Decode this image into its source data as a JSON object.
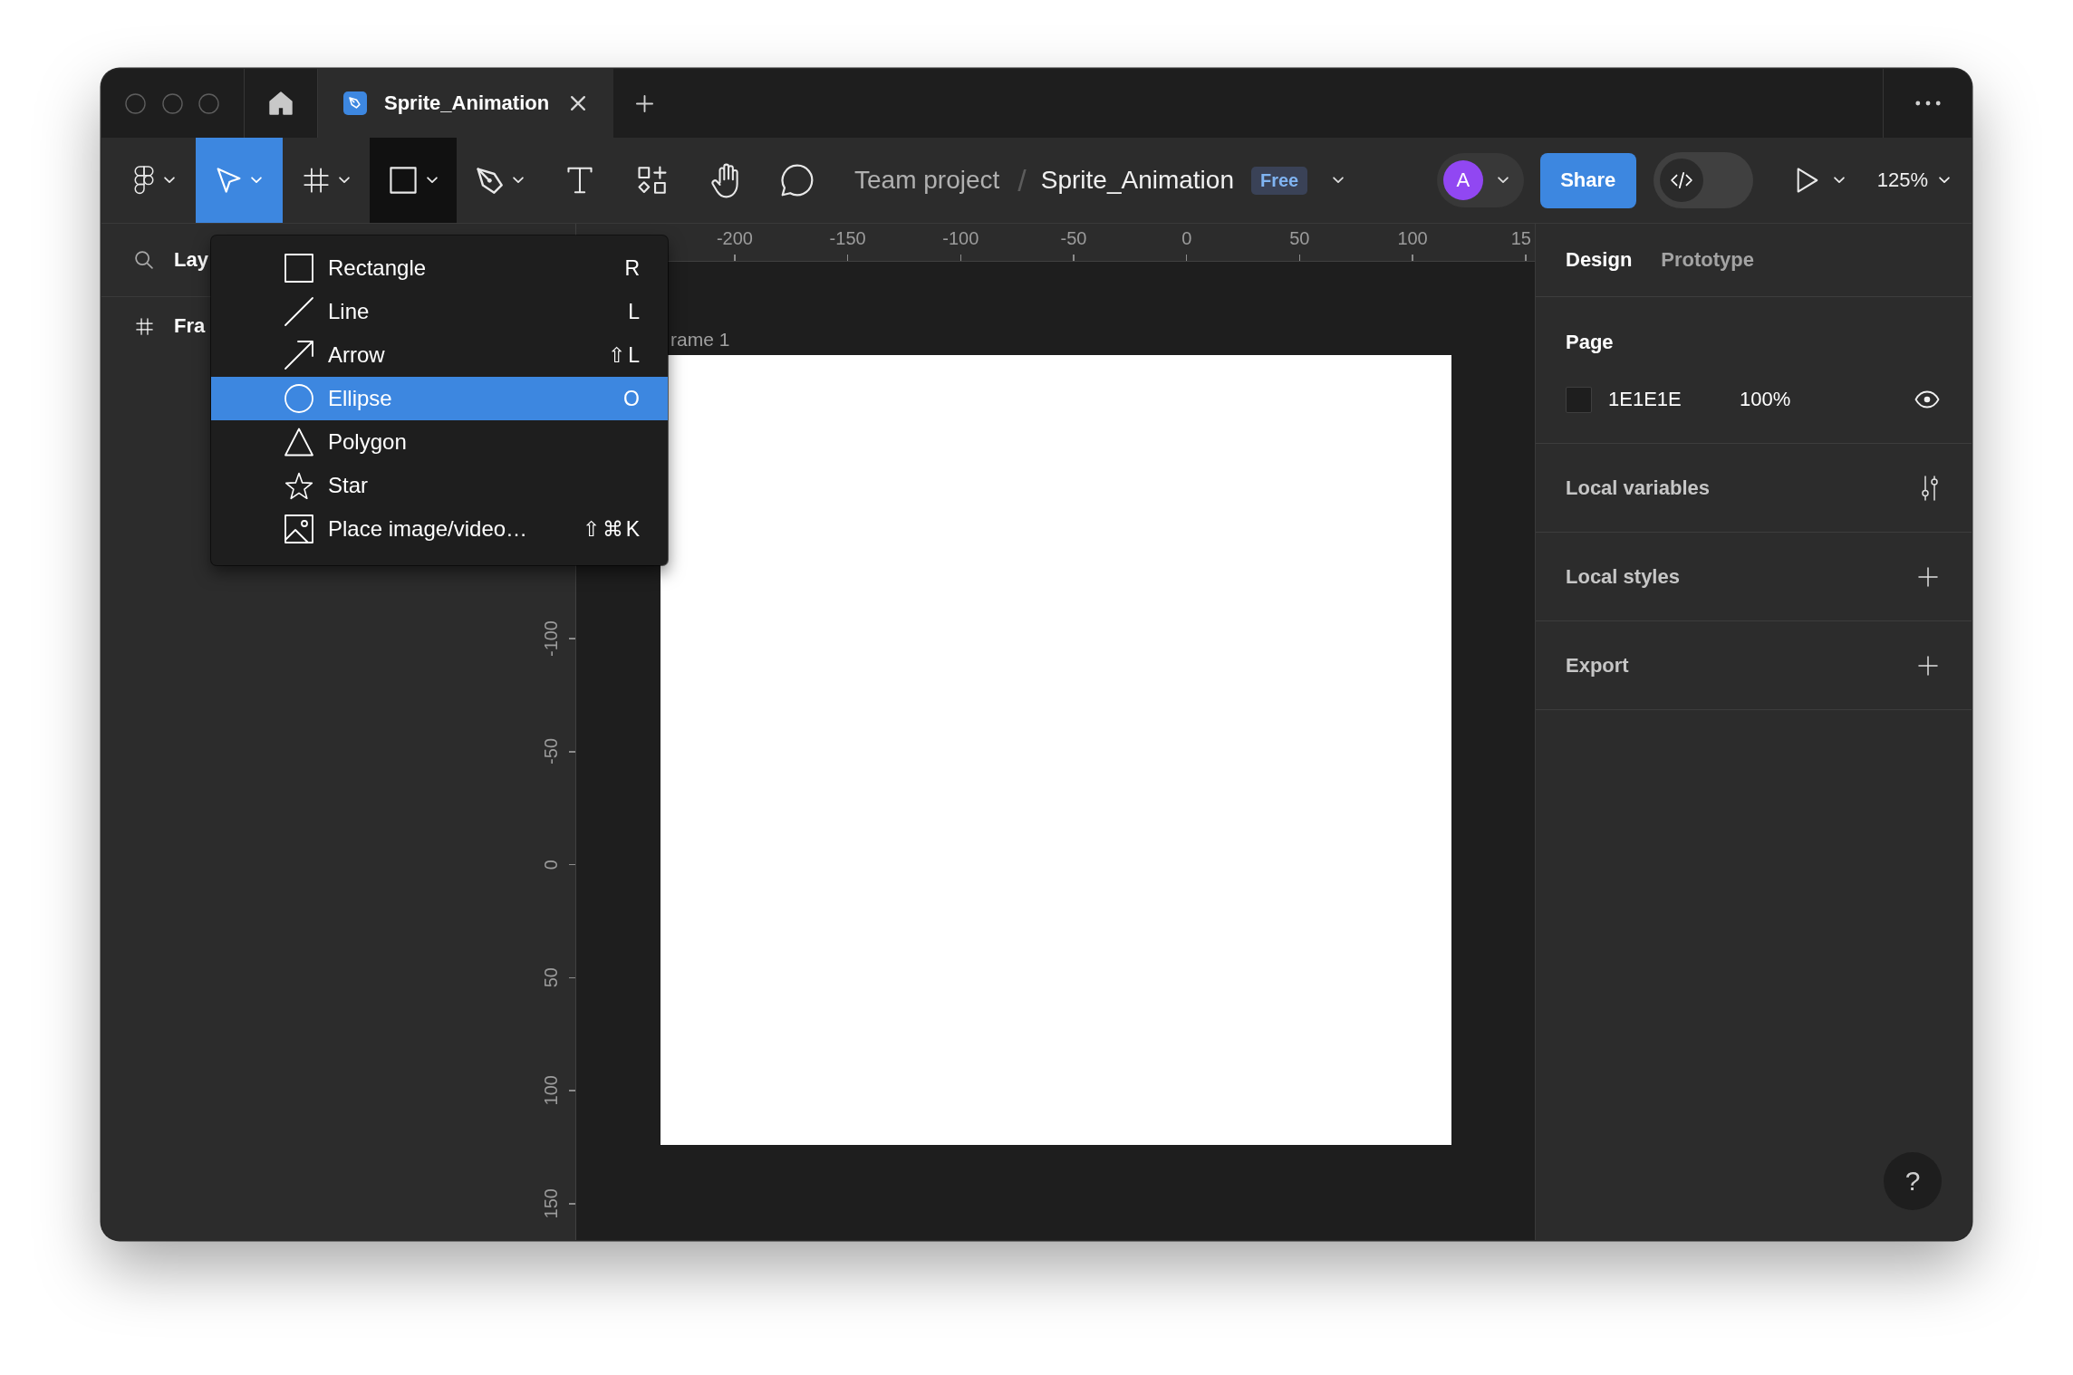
{
  "title_bar": {
    "tabs": [
      {
        "title": "Sprite_Animation",
        "selected": true
      }
    ]
  },
  "toolbar": {
    "tools": [
      {
        "kind": "main-menu",
        "dropdown": true,
        "selected": false,
        "menu_open": false
      },
      {
        "kind": "move",
        "dropdown": true,
        "selected": true,
        "menu_open": false
      },
      {
        "kind": "frame",
        "dropdown": true,
        "selected": false,
        "menu_open": false
      },
      {
        "kind": "rectangle",
        "dropdown": true,
        "selected": false,
        "menu_open": true
      },
      {
        "kind": "pen",
        "dropdown": true,
        "selected": false,
        "menu_open": false
      },
      {
        "kind": "text",
        "dropdown": false,
        "selected": false,
        "menu_open": false
      },
      {
        "kind": "resources",
        "dropdown": false,
        "selected": false,
        "menu_open": false
      },
      {
        "kind": "hand",
        "dropdown": false,
        "selected": false,
        "menu_open": false
      },
      {
        "kind": "comment",
        "dropdown": false,
        "selected": false,
        "menu_open": false
      }
    ],
    "breadcrumb": {
      "project": "Team project",
      "separator": "/",
      "file": "Sprite_Animation",
      "plan_badge": "Free"
    },
    "avatar": {
      "initial": "A"
    },
    "share_button": "Share",
    "dev_mode": {
      "on": false
    },
    "zoom": "125%"
  },
  "layers_panel": {
    "header": "Lay",
    "layers": [
      {
        "kind": "frame",
        "name": "Fra"
      }
    ]
  },
  "rulers": {
    "horizontal": [
      "-200",
      "-150",
      "-100",
      "-50",
      "0",
      "50",
      "100",
      "15"
    ],
    "vertical": [
      "-100",
      "-50",
      "0",
      "50",
      "100",
      "150"
    ]
  },
  "canvas": {
    "frame_label": "rame 1"
  },
  "shape_menu": {
    "items": [
      {
        "kind": "rectangle",
        "label": "Rectangle",
        "shortcut": "R",
        "selected": false
      },
      {
        "kind": "line",
        "label": "Line",
        "shortcut": "L",
        "selected": false
      },
      {
        "kind": "arrow",
        "label": "Arrow",
        "shortcut": "⇧L",
        "selected": false
      },
      {
        "kind": "ellipse",
        "label": "Ellipse",
        "shortcut": "O",
        "selected": true
      },
      {
        "kind": "polygon",
        "label": "Polygon",
        "selected": false
      },
      {
        "kind": "star",
        "label": "Star",
        "selected": false
      },
      {
        "kind": "image",
        "label": "Place image/video…",
        "shortcut": "⇧⌘K",
        "selected": false
      }
    ]
  },
  "properties_panel": {
    "tabs": [
      {
        "label": "Design",
        "selected": true
      },
      {
        "label": "Prototype",
        "selected": false
      }
    ],
    "page": {
      "title": "Page",
      "hex": "1E1E1E",
      "opacity": "100%",
      "visible": true
    },
    "sections": [
      {
        "title": "Local variables",
        "kind": "variables"
      },
      {
        "title": "Local styles",
        "kind": "add"
      },
      {
        "title": "Export",
        "kind": "add"
      }
    ],
    "help": "?"
  }
}
